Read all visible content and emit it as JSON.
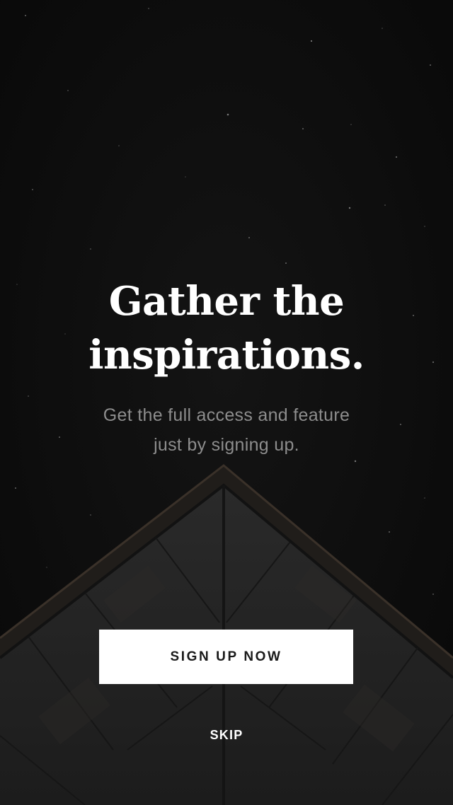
{
  "onboarding": {
    "headline_line1": "Gather the",
    "headline_line2": "inspirations.",
    "subtitle_line1": "Get the full access and feature",
    "subtitle_line2": "just by signing up.",
    "signup_label": "SIGN UP NOW",
    "skip_label": "SKIP"
  },
  "colors": {
    "background": "#0c0c0c",
    "headline": "#ffffff",
    "subtitle": "#8d8d8d",
    "button_bg": "#ffffff",
    "button_text": "#1a1a1a"
  }
}
